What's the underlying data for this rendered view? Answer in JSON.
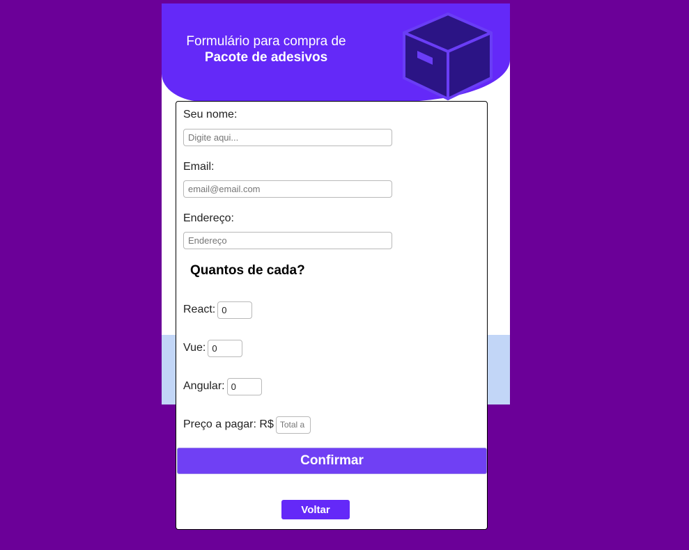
{
  "header": {
    "title_line1": "Formulário para compra de",
    "title_line2": "Pacote de adesivos"
  },
  "form": {
    "name_label": "Seu nome:",
    "name_placeholder": "Digite aqui...",
    "email_label": "Email:",
    "email_placeholder": "email@email.com",
    "address_label": "Endereço:",
    "address_placeholder": "Endereço",
    "section_title": "Quantos de cada?",
    "react_label": "React:",
    "react_value": "0",
    "vue_label": "Vue:",
    "vue_value": "0",
    "angular_label": "Angular:",
    "angular_value": "0",
    "price_label": "Preço a pagar: R$",
    "price_placeholder": "Total a pagar",
    "confirm_label": "Confirmar",
    "back_label": "Voltar"
  },
  "icons": {
    "header_icon": "package-box-icon"
  },
  "colors": {
    "page_bg": "#6b0098",
    "header_bg": "#6429f8",
    "box_dark": "#2b1485",
    "confirm_bg": "#7040f4",
    "lower_band": "#c2d6f7"
  }
}
